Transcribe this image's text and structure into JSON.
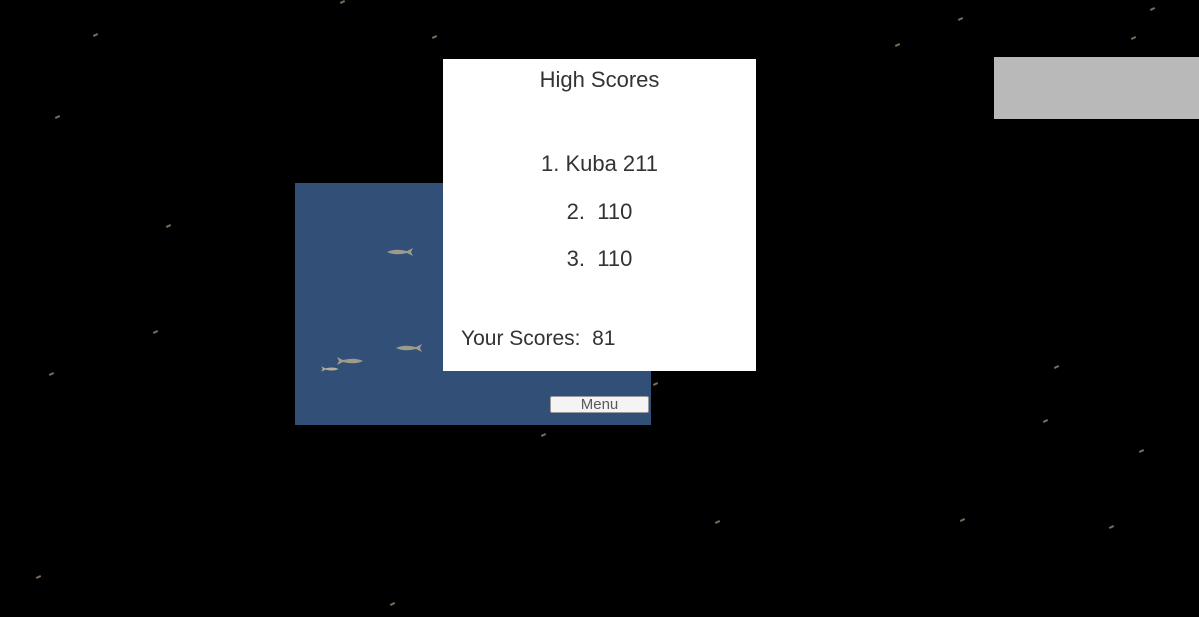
{
  "high_scores": {
    "title": "High Scores",
    "entries": [
      "1. Kuba 211",
      "2.  110",
      "3.  110"
    ],
    "your_score_label": "Your Scores:  81"
  },
  "menu_button_label": "Menu",
  "colors": {
    "background": "#000000",
    "water": "#324f78",
    "panel": "#ffffff",
    "corner_panel": "#b9b9b9"
  },
  "icons": [
    "fish-icon"
  ]
}
